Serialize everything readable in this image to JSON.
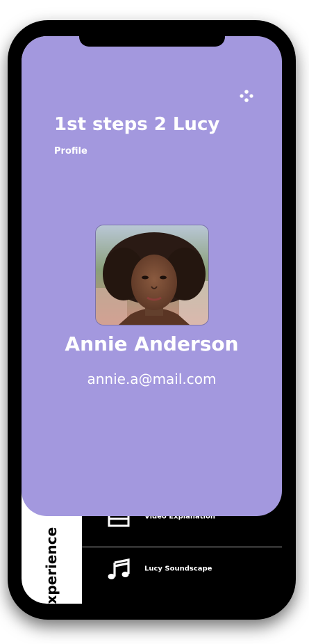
{
  "app": {
    "title": "1st steps 2 Lucy"
  },
  "page": {
    "subtitle": "Profile"
  },
  "profile": {
    "name": "Annie Anderson",
    "email": "annie.a@mail.com",
    "avatar_icon": "profile-photo"
  },
  "header": {
    "menu_icon": "dots-menu-icon"
  },
  "bottom_menu": {
    "side_label": "experience",
    "items": [
      {
        "label": "Video Explanation",
        "icon": "video-list-icon"
      },
      {
        "label": "Lucy Soundscape",
        "icon": "music-note-icon"
      }
    ]
  },
  "colors": {
    "card_background": "#a398de",
    "screen_background": "#000000",
    "text": "#ffffff"
  }
}
